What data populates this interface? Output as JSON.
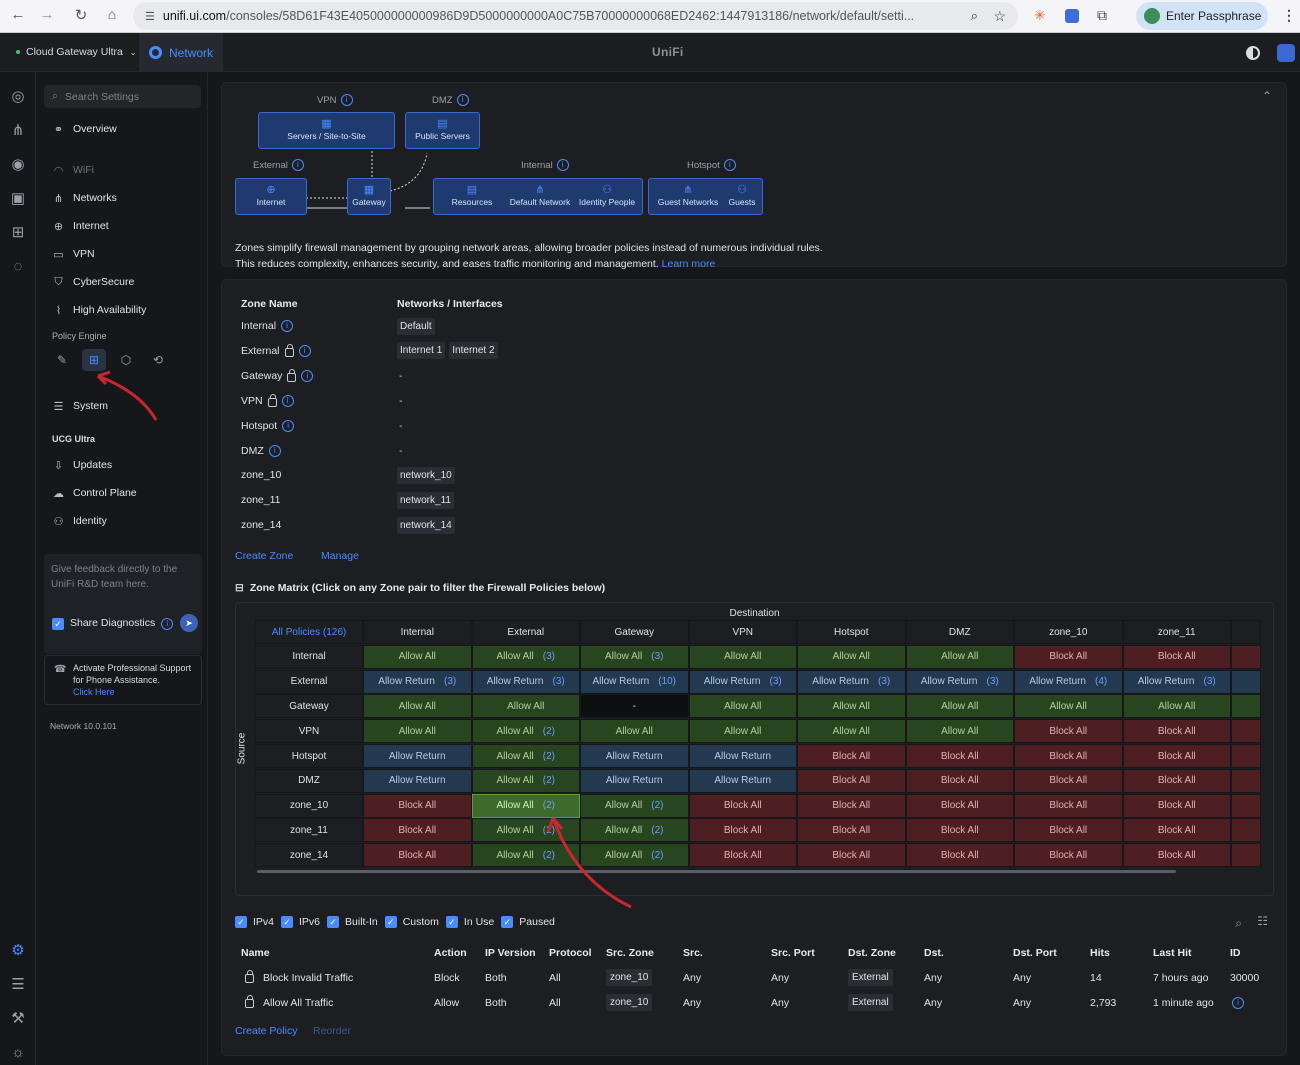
{
  "browser": {
    "url_host": "unifi.ui.com",
    "url_path": "/consoles/58D61F43E405000000000986D9D5000000000A0C75B70000000068ED2462:1447913186/network/default/setti...",
    "passphrase_label": "Enter Passphrase"
  },
  "topbar": {
    "device": "Cloud Gateway Ultra",
    "app_tab": "Network",
    "brand": "UniFi"
  },
  "sidebar": {
    "search_placeholder": "Search Settings",
    "items": [
      {
        "label": "Overview"
      },
      {
        "label": "WiFi"
      },
      {
        "label": "Networks"
      },
      {
        "label": "Internet"
      },
      {
        "label": "VPN"
      },
      {
        "label": "CyberSecure"
      },
      {
        "label": "High Availability"
      }
    ],
    "policy_engine_heading": "Policy Engine",
    "system_label": "System",
    "ucg_heading": "UCG Ultra",
    "ucg_items": [
      {
        "label": "Updates"
      },
      {
        "label": "Control Plane"
      },
      {
        "label": "Identity"
      }
    ],
    "feedback_text": "Give feedback directly to the UniFi R&D team here.",
    "share_diagnostics": "Share Diagnostics",
    "support_text": "Activate Professional Support for Phone Assistance.",
    "support_link": "Click Here",
    "version": "Network 10.0.101"
  },
  "diagram": {
    "vpn_label": "VPN",
    "dmz_label": "DMZ",
    "external_label": "External",
    "internal_label": "Internal",
    "hotspot_label": "Hotspot",
    "servers": "Servers / Site-to-Site",
    "public_servers": "Public Servers",
    "internet": "Internet",
    "gateway": "Gateway",
    "resources": "Resources",
    "default_network": "Default Network",
    "identity_people": "Identity People",
    "guest_networks": "Guest Networks",
    "guests": "Guests",
    "description": "Zones simplify firewall management by grouping network areas, allowing broader policies instead of numerous individual rules. This reduces complexity, enhances security, and eases traffic monitoring and management.",
    "learn_more": "Learn more"
  },
  "zones": {
    "col_name": "Zone Name",
    "col_networks": "Networks / Interfaces",
    "rows": [
      {
        "name": "Internal",
        "lock": false,
        "info": true,
        "networks": [
          "Default"
        ]
      },
      {
        "name": "External",
        "lock": true,
        "info": true,
        "networks": [
          "Internet 1",
          "Internet 2"
        ]
      },
      {
        "name": "Gateway",
        "lock": true,
        "info": true,
        "networks": []
      },
      {
        "name": "VPN",
        "lock": true,
        "info": true,
        "networks": []
      },
      {
        "name": "Hotspot",
        "lock": false,
        "info": true,
        "networks": []
      },
      {
        "name": "DMZ",
        "lock": false,
        "info": true,
        "networks": []
      },
      {
        "name": "zone_10",
        "lock": false,
        "info": false,
        "networks": [
          "network_10"
        ]
      },
      {
        "name": "zone_11",
        "lock": false,
        "info": false,
        "networks": [
          "network_11"
        ]
      },
      {
        "name": "zone_14",
        "lock": false,
        "info": false,
        "networks": [
          "network_14"
        ]
      }
    ],
    "empty": "-",
    "create_zone": "Create Zone",
    "manage": "Manage"
  },
  "matrix": {
    "title": "Zone Matrix (Click on any Zone pair to filter the Firewall Policies below)",
    "destination": "Destination",
    "source": "Source",
    "all_policies": "All Policies (126)",
    "columns": [
      "Internal",
      "External",
      "Gateway",
      "VPN",
      "Hotspot",
      "DMZ",
      "zone_10",
      "zone_11"
    ],
    "rows": [
      {
        "name": "Internal",
        "cells": [
          [
            "aa",
            "Allow All",
            ""
          ],
          [
            "aa",
            "Allow All",
            "(3)"
          ],
          [
            "aa",
            "Allow All",
            "(3)"
          ],
          [
            "aa",
            "Allow All",
            ""
          ],
          [
            "aa",
            "Allow All",
            ""
          ],
          [
            "aa",
            "Allow All",
            ""
          ],
          [
            "ba",
            "Block All",
            ""
          ],
          [
            "ba",
            "Block All",
            ""
          ]
        ]
      },
      {
        "name": "External",
        "cells": [
          [
            "ar",
            "Allow Return",
            "(3)"
          ],
          [
            "ar",
            "Allow Return",
            "(3)"
          ],
          [
            "ar",
            "Allow Return",
            "(10)"
          ],
          [
            "ar",
            "Allow Return",
            "(3)"
          ],
          [
            "ar",
            "Allow Return",
            "(3)"
          ],
          [
            "ar",
            "Allow Return",
            "(3)"
          ],
          [
            "ar",
            "Allow Return",
            "(4)"
          ],
          [
            "ar",
            "Allow Return",
            "(3)"
          ]
        ]
      },
      {
        "name": "Gateway",
        "cells": [
          [
            "aa",
            "Allow All",
            ""
          ],
          [
            "aa",
            "Allow All",
            ""
          ],
          [
            "dash",
            "-",
            ""
          ],
          [
            "aa",
            "Allow All",
            ""
          ],
          [
            "aa",
            "Allow All",
            ""
          ],
          [
            "aa",
            "Allow All",
            ""
          ],
          [
            "aa",
            "Allow All",
            ""
          ],
          [
            "aa",
            "Allow All",
            ""
          ]
        ]
      },
      {
        "name": "VPN",
        "cells": [
          [
            "aa",
            "Allow All",
            ""
          ],
          [
            "aa",
            "Allow All",
            "(2)"
          ],
          [
            "aa",
            "Allow All",
            ""
          ],
          [
            "aa",
            "Allow All",
            ""
          ],
          [
            "aa",
            "Allow All",
            ""
          ],
          [
            "aa",
            "Allow All",
            ""
          ],
          [
            "ba",
            "Block All",
            ""
          ],
          [
            "ba",
            "Block All",
            ""
          ]
        ]
      },
      {
        "name": "Hotspot",
        "cells": [
          [
            "ar",
            "Allow Return",
            ""
          ],
          [
            "aa",
            "Allow All",
            "(2)"
          ],
          [
            "ar",
            "Allow Return",
            ""
          ],
          [
            "ar",
            "Allow Return",
            ""
          ],
          [
            "ba",
            "Block All",
            ""
          ],
          [
            "ba",
            "Block All",
            ""
          ],
          [
            "ba",
            "Block All",
            ""
          ],
          [
            "ba",
            "Block All",
            ""
          ]
        ]
      },
      {
        "name": "DMZ",
        "cells": [
          [
            "ar",
            "Allow Return",
            ""
          ],
          [
            "aa",
            "Allow All",
            "(2)"
          ],
          [
            "ar",
            "Allow Return",
            ""
          ],
          [
            "ar",
            "Allow Return",
            ""
          ],
          [
            "ba",
            "Block All",
            ""
          ],
          [
            "ba",
            "Block All",
            ""
          ],
          [
            "ba",
            "Block All",
            ""
          ],
          [
            "ba",
            "Block All",
            ""
          ]
        ]
      },
      {
        "name": "zone_10",
        "cells": [
          [
            "ba",
            "Block All",
            ""
          ],
          [
            "sel",
            "Allow All",
            "(2)"
          ],
          [
            "aa",
            "Allow All",
            "(2)"
          ],
          [
            "ba",
            "Block All",
            ""
          ],
          [
            "ba",
            "Block All",
            ""
          ],
          [
            "ba",
            "Block All",
            ""
          ],
          [
            "ba",
            "Block All",
            ""
          ],
          [
            "ba",
            "Block All",
            ""
          ]
        ]
      },
      {
        "name": "zone_11",
        "cells": [
          [
            "ba",
            "Block All",
            ""
          ],
          [
            "aa",
            "Allow All",
            "(2)"
          ],
          [
            "aa",
            "Allow All",
            "(2)"
          ],
          [
            "ba",
            "Block All",
            ""
          ],
          [
            "ba",
            "Block All",
            ""
          ],
          [
            "ba",
            "Block All",
            ""
          ],
          [
            "ba",
            "Block All",
            ""
          ],
          [
            "ba",
            "Block All",
            ""
          ]
        ]
      },
      {
        "name": "zone_14",
        "cells": [
          [
            "ba",
            "Block All",
            ""
          ],
          [
            "aa",
            "Allow All",
            "(2)"
          ],
          [
            "aa",
            "Allow All",
            "(2)"
          ],
          [
            "ba",
            "Block All",
            ""
          ],
          [
            "ba",
            "Block All",
            ""
          ],
          [
            "ba",
            "Block All",
            ""
          ],
          [
            "ba",
            "Block All",
            ""
          ],
          [
            "ba",
            "Block All",
            ""
          ]
        ]
      }
    ],
    "colors": {
      "allow_all": "#27451e",
      "allow_return": "#23394f",
      "block_all": "#4d1e22",
      "accent": "#4a8cff"
    }
  },
  "filters": [
    "IPv4",
    "IPv6",
    "Built-In",
    "Custom",
    "In Use",
    "Paused"
  ],
  "policies": {
    "headers": [
      "Name",
      "Action",
      "IP Version",
      "Protocol",
      "Src. Zone",
      "Src.",
      "Src. Port",
      "Dst. Zone",
      "Dst.",
      "Dst. Port",
      "Hits",
      "Last Hit",
      "ID"
    ],
    "rows": [
      {
        "name": "Block Invalid Traffic",
        "action": "Block",
        "ip": "Both",
        "protocol": "All",
        "src_zone": "zone_10",
        "src": "Any",
        "src_port": "Any",
        "dst_zone": "External",
        "dst": "Any",
        "dst_port": "Any",
        "hits": "14",
        "last_hit": "7 hours ago",
        "id": "30000"
      },
      {
        "name": "Allow All Traffic",
        "action": "Allow",
        "ip": "Both",
        "protocol": "All",
        "src_zone": "zone_10",
        "src": "Any",
        "src_port": "Any",
        "dst_zone": "External",
        "dst": "Any",
        "dst_port": "Any",
        "hits": "2,793",
        "last_hit": "1 minute ago",
        "id": ""
      }
    ],
    "create_policy": "Create Policy",
    "reorder": "Reorder"
  }
}
